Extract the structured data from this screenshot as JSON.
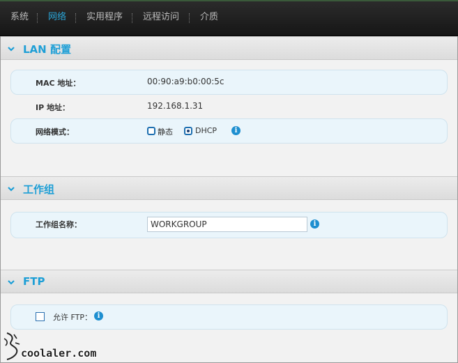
{
  "nav": {
    "items": [
      {
        "label": "系统",
        "active": false
      },
      {
        "label": "网络",
        "active": true
      },
      {
        "label": "实用程序",
        "active": false
      },
      {
        "label": "远程访问",
        "active": false
      },
      {
        "label": "介质",
        "active": false
      }
    ]
  },
  "lan": {
    "title": "LAN 配置",
    "mac_label": "MAC 地址：",
    "mac_value": "00:90:a9:b0:00:5c",
    "ip_label": "IP 地址：",
    "ip_value": "192.168.1.31",
    "mode_label": "网络模式：",
    "mode_options": [
      {
        "label": "静态",
        "selected": false
      },
      {
        "label": "DHCP",
        "selected": true
      }
    ]
  },
  "workgroup": {
    "title": "工作组",
    "name_label": "工作组名称：",
    "name_value": "WORKGROUP"
  },
  "ftp": {
    "title": "FTP",
    "allow_label": "允许 FTP：",
    "allow_checked": false
  },
  "watermark": {
    "text": "coolaler.com"
  },
  "colors": {
    "accent": "#1e9fd6",
    "nav_bg": "#1c1c1c",
    "row_bg": "#eaf5fb"
  }
}
